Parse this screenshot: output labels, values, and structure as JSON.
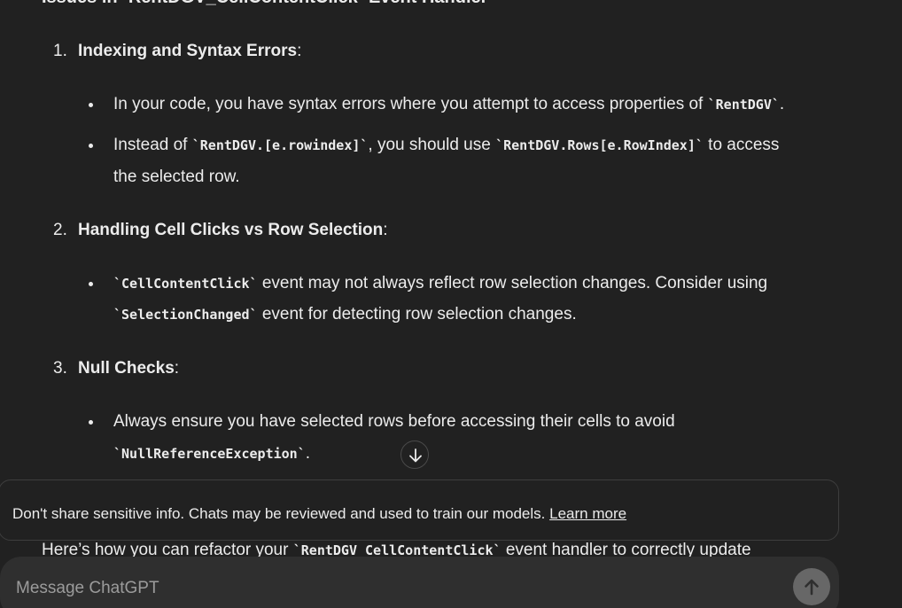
{
  "content": {
    "heading": "Issues in `RentDGV_CellContentClick` Event Handler",
    "sections": [
      {
        "number": "1.",
        "title": "Indexing and Syntax Errors",
        "bullets": [
          {
            "parts": [
              "In your code, you have syntax errors where you attempt to access properties of ",
              "`RentDGV`",
              "."
            ]
          },
          {
            "line1": [
              "Instead of ",
              "`RentDGV.[e.rowindex]`",
              ", you should use ",
              "`RentDGV.Rows[e.RowIndex]`",
              " to access"
            ],
            "line2": "the selected row."
          }
        ]
      },
      {
        "number": "2.",
        "title": "Handling Cell Clicks vs Row Selection",
        "bullets": [
          {
            "line1": [
              "`CellContentClick`",
              " event may not always reflect row selection changes. Consider using"
            ],
            "line2": [
              "`SelectionChanged`",
              " event for detecting row selection changes."
            ]
          }
        ]
      },
      {
        "number": "3.",
        "title": "Null Checks",
        "bullets": [
          {
            "line1": "Always ensure you have selected rows before accessing their cells to avoid",
            "line2": [
              "`NullReferenceException`",
              "."
            ]
          }
        ]
      }
    ],
    "partial_line": [
      "Here’s how you can refactor your ",
      "`RentDGV_CellContentClick`",
      " event handler to correctly update"
    ]
  },
  "notice": {
    "text": "Don't share sensitive info. Chats may be reviewed and used to train our models.",
    "link": "Learn more"
  },
  "composer": {
    "placeholder": "Message ChatGPT"
  },
  "icons": {
    "scroll": "arrow-down-icon",
    "send": "arrow-up-icon"
  }
}
